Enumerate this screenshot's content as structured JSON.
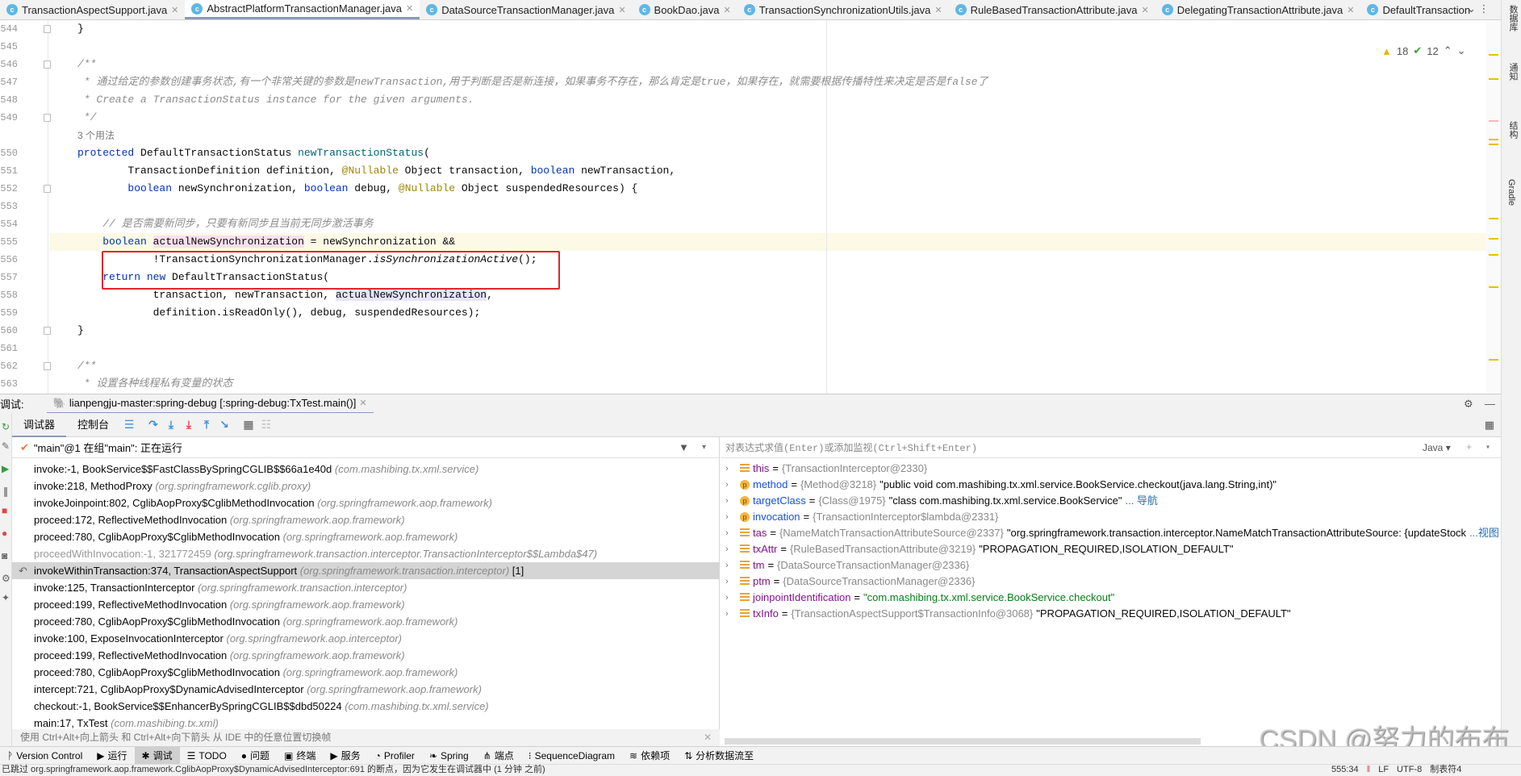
{
  "tabs": [
    {
      "label": "TransactionAspectSupport.java",
      "active": false
    },
    {
      "label": "AbstractPlatformTransactionManager.java",
      "active": true
    },
    {
      "label": "DataSourceTransactionManager.java",
      "active": false
    },
    {
      "label": "BookDao.java",
      "active": false
    },
    {
      "label": "TransactionSynchronizationUtils.java",
      "active": false
    },
    {
      "label": "RuleBasedTransactionAttribute.java",
      "active": false
    },
    {
      "label": "DelegatingTransactionAttribute.java",
      "active": false
    },
    {
      "label": "DefaultTransaction",
      "active": false
    }
  ],
  "right_strip": [
    "数据库",
    "通知",
    "结构",
    "Gradle"
  ],
  "inspections": {
    "warnings": "18",
    "weak_warnings": "12"
  },
  "editor": {
    "usage_hint": "3 个用法",
    "current_line": "555",
    "lines": [
      {
        "n": "544",
        "fold": true,
        "toks": [
          [
            "}",
            ""
          ]
        ]
      },
      {
        "n": "545",
        "toks": []
      },
      {
        "n": "546",
        "fold": true,
        "toks": [
          [
            "/**",
            "cm"
          ]
        ]
      },
      {
        "n": "547",
        "toks": [
          [
            " * 通过给定的参数创建事务状态,有一个非常关键的参数是newTransaction,用于判断是否是新连接，如果事务不存在，那么肯定是true，如果存在，就需要根据传播特性来决定是否是false了",
            "cm"
          ]
        ]
      },
      {
        "n": "548",
        "toks": [
          [
            " * Create a TransactionStatus instance for the given arguments.",
            "cm"
          ]
        ]
      },
      {
        "n": "549",
        "fold": true,
        "toks": [
          [
            " */",
            "cm"
          ]
        ]
      },
      {
        "hint": true
      },
      {
        "n": "550",
        "toks": [
          [
            "protected",
            "kw"
          ],
          [
            " DefaultTransactionStatus ",
            ""
          ],
          [
            "newTransactionStatus",
            "fn"
          ],
          [
            "(",
            ""
          ]
        ]
      },
      {
        "n": "551",
        "toks": [
          [
            "        TransactionDefinition definition, ",
            ""
          ],
          [
            "@Nullable",
            "ann"
          ],
          [
            " Object transaction, ",
            ""
          ],
          [
            "boolean",
            "kw"
          ],
          [
            " newTransaction,",
            ""
          ]
        ]
      },
      {
        "n": "552",
        "fold": true,
        "toks": [
          [
            "        ",
            ""
          ],
          [
            "boolean",
            "kw"
          ],
          [
            " newSynchronization, ",
            ""
          ],
          [
            "boolean",
            "kw"
          ],
          [
            " debug, ",
            ""
          ],
          [
            "@Nullable",
            "ann"
          ],
          [
            " Object suspendedResources) {",
            ""
          ]
        ]
      },
      {
        "n": "553",
        "toks": []
      },
      {
        "n": "554",
        "toks": [
          [
            "    // 是否需要新同步，只要有新同步且当前无同步激活事务",
            "cm"
          ]
        ]
      },
      {
        "n": "555",
        "toks": [
          [
            "    ",
            ""
          ],
          [
            "boolean",
            "kw"
          ],
          [
            " ",
            ""
          ],
          [
            "actualNewSynchronization",
            "hl"
          ],
          [
            " = newSynchronization &&",
            ""
          ]
        ]
      },
      {
        "n": "556",
        "toks": [
          [
            "            !TransactionSynchronizationManager.",
            ""
          ],
          [
            "isSynchronizationActive",
            "it"
          ],
          [
            "();",
            ""
          ]
        ]
      },
      {
        "n": "557",
        "toks": [
          [
            "    ",
            ""
          ],
          [
            "return",
            "kw"
          ],
          [
            " ",
            ""
          ],
          [
            "new",
            "kw"
          ],
          [
            " DefaultTransactionStatus(",
            ""
          ]
        ]
      },
      {
        "n": "558",
        "toks": [
          [
            "            transaction, newTransaction, ",
            ""
          ],
          [
            "actualNewSynchronization",
            "hl2"
          ],
          [
            ",",
            ""
          ]
        ]
      },
      {
        "n": "559",
        "toks": [
          [
            "            definition.isReadOnly(), debug, suspendedResources);",
            ""
          ]
        ]
      },
      {
        "n": "560",
        "fold": true,
        "toks": [
          [
            "}",
            ""
          ]
        ]
      },
      {
        "n": "561",
        "toks": []
      },
      {
        "n": "562",
        "fold": true,
        "toks": [
          [
            "/**",
            "cm"
          ]
        ]
      },
      {
        "n": "563",
        "toks": [
          [
            " * 设置各种线程私有变量的状态",
            "cm"
          ]
        ]
      }
    ]
  },
  "debug": {
    "label": "调试:",
    "session": "lianpengju-master:spring-debug [:spring-debug:TxTest.main()]",
    "tabs": [
      "调试器",
      "控制台"
    ],
    "thread": "\"main\"@1 在组\"main\": 正在运行",
    "frames": [
      {
        "m": "invoke:-1, BookService$$FastClassBySpringCGLIB$$66a1e40d",
        "p": "(com.mashibing.tx.xml.service)"
      },
      {
        "m": "invoke:218, MethodProxy",
        "p": "(org.springframework.cglib.proxy)"
      },
      {
        "m": "invokeJoinpoint:802, CglibAopProxy$CglibMethodInvocation",
        "p": "(org.springframework.aop.framework)"
      },
      {
        "m": "proceed:172, ReflectiveMethodInvocation",
        "p": "(org.springframework.aop.framework)"
      },
      {
        "m": "proceed:780, CglibAopProxy$CglibMethodInvocation",
        "p": "(org.springframework.aop.framework)"
      },
      {
        "m": "proceedWithInvocation:-1, 321772459",
        "p": "(org.springframework.transaction.interceptor.TransactionInterceptor$$Lambda$47)",
        "dim": true
      },
      {
        "m": "invokeWithinTransaction:374, TransactionAspectSupport",
        "p": "(org.springframework.transaction.interceptor)",
        "extra": " [1]",
        "sel": true
      },
      {
        "m": "invoke:125, TransactionInterceptor",
        "p": "(org.springframework.transaction.interceptor)"
      },
      {
        "m": "proceed:199, ReflectiveMethodInvocation",
        "p": "(org.springframework.aop.framework)"
      },
      {
        "m": "proceed:780, CglibAopProxy$CglibMethodInvocation",
        "p": "(org.springframework.aop.framework)"
      },
      {
        "m": "invoke:100, ExposeInvocationInterceptor",
        "p": "(org.springframework.aop.interceptor)"
      },
      {
        "m": "proceed:199, ReflectiveMethodInvocation",
        "p": "(org.springframework.aop.framework)"
      },
      {
        "m": "proceed:780, CglibAopProxy$CglibMethodInvocation",
        "p": "(org.springframework.aop.framework)"
      },
      {
        "m": "intercept:721, CglibAopProxy$DynamicAdvisedInterceptor",
        "p": "(org.springframework.aop.framework)"
      },
      {
        "m": "checkout:-1, BookService$$EnhancerBySpringCGLIB$$dbd50224",
        "p": "(com.mashibing.tx.xml.service)"
      },
      {
        "m": "main:17, TxTest",
        "p": "(com.mashibing.tx.xml)"
      }
    ],
    "frames_hint": "使用 Ctrl+Alt+向上箭头 和 Ctrl+Alt+向下箭头 从 IDE 中的任意位置切换帧",
    "eval_placeholder": "对表达式求值(Enter)或添加监视(Ctrl+Shift+Enter)",
    "lang": "Java",
    "vars": [
      {
        "k": "f",
        "n": "this",
        "t": "{TransactionInterceptor@2330}",
        "v": ""
      },
      {
        "k": "p",
        "n": "method",
        "t": "{Method@3218}",
        "v": "\"public void com.mashibing.tx.xml.service.BookService.checkout(java.lang.String,int)\""
      },
      {
        "k": "p",
        "n": "targetClass",
        "t": "{Class@1975}",
        "v": "\"class com.mashibing.tx.xml.service.BookService\"",
        "link": "... 导航"
      },
      {
        "k": "p",
        "n": "invocation",
        "t": "{TransactionInterceptor$lambda@2331}",
        "v": ""
      },
      {
        "k": "f",
        "n": "tas",
        "t": "{NameMatchTransactionAttributeSource@2337}",
        "v": "\"org.springframework.transaction.interceptor.NameMatchTransactionAttributeSource: {updateStock",
        "link": "...视图"
      },
      {
        "k": "f",
        "n": "txAttr",
        "t": "{RuleBasedTransactionAttribute@3219}",
        "v": "\"PROPAGATION_REQUIRED,ISOLATION_DEFAULT\""
      },
      {
        "k": "f",
        "n": "tm",
        "t": "{DataSourceTransactionManager@2336}",
        "v": ""
      },
      {
        "k": "f",
        "n": "ptm",
        "t": "{DataSourceTransactionManager@2336}",
        "v": ""
      },
      {
        "k": "f",
        "n": "joinpointIdentification",
        "t": "",
        "v": "\"com.mashibing.tx.xml.service.BookService.checkout\"",
        "str": true
      },
      {
        "k": "f",
        "n": "txInfo",
        "t": "{TransactionAspectSupport$TransactionInfo@3068}",
        "v": "\"PROPAGATION_REQUIRED,ISOLATION_DEFAULT\""
      }
    ]
  },
  "toolwindows": [
    {
      "label": "Version Control",
      "icon": "ᚹ"
    },
    {
      "label": "运行",
      "icon": "▶"
    },
    {
      "label": "调试",
      "icon": "✱",
      "active": true
    },
    {
      "label": "TODO",
      "icon": "☰"
    },
    {
      "label": "问题",
      "icon": "●"
    },
    {
      "label": "终端",
      "icon": "▣"
    },
    {
      "label": "服务",
      "icon": "▶"
    },
    {
      "label": "Profiler",
      "icon": "◔"
    },
    {
      "label": "Spring",
      "icon": "❧"
    },
    {
      "label": "端点",
      "icon": "⋔"
    },
    {
      "label": "SequenceDiagram",
      "icon": "⁝"
    },
    {
      "label": "依赖项",
      "icon": "≋"
    },
    {
      "label": "分析数据流至",
      "icon": "⇅"
    }
  ],
  "status": {
    "message": "已跳过 org.springframework.aop.framework.CglibAopProxy$DynamicAdvisedInterceptor:691 的断点，因为它发生在调试器中 (1 分钟 之前)",
    "position": "555:34",
    "line_sep": "LF",
    "encoding": "UTF-8",
    "indent": "制表符4"
  },
  "watermark": "CSDN @努力的布布",
  "colors": {
    "keyword": "#0033b3",
    "annotation": "#9e880d",
    "comment": "#8c8c8c",
    "highlight_box": "#e8222b",
    "string": "#067d17"
  }
}
